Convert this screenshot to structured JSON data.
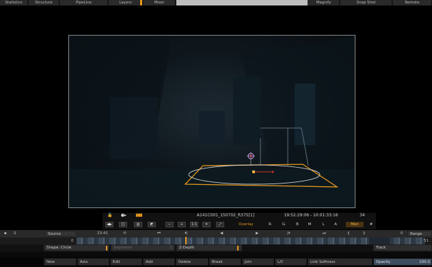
{
  "top_tabs": [
    {
      "label": "Statistics"
    },
    {
      "label": "Structure"
    },
    {
      "label": "PipeLine"
    },
    {
      "label": "Layers"
    },
    {
      "label": "Mixer"
    },
    {
      "label": "Magnify"
    },
    {
      "label": "Snap Shot"
    },
    {
      "label": "Remote"
    }
  ],
  "player": {
    "clip_name": "A141C001_150702_R375[1]",
    "timecode_range": "19:52:29:06 - 10:01:33:16",
    "frame_count": "34",
    "modes": [
      "Overlay",
      "R",
      "G",
      "B",
      "M",
      "L",
      "A",
      "Mon"
    ],
    "hash_icon": "#"
  },
  "source_row": {
    "s_label": "S",
    "source_label": "Source",
    "source_value": "23:41",
    "range_label": "Range",
    "zero_left": "0",
    "zero_right": "0",
    "value_right": "51"
  },
  "shape_row": {
    "shape_label": "Shape: Circle",
    "segments_label": "Segments",
    "segments_value": "1",
    "zdepth_label": "Z-Depth",
    "track_label": "Track"
  },
  "button_row": [
    {
      "label": "New",
      "disabled": false
    },
    {
      "label": "Axis",
      "disabled": false
    },
    {
      "label": "Edit",
      "disabled": false
    },
    {
      "label": "Add",
      "disabled": false
    },
    {
      "label": "Delete",
      "disabled": false
    },
    {
      "label": "Break",
      "disabled": false
    },
    {
      "label": "Join",
      "disabled": false
    },
    {
      "label": "L/C",
      "disabled": false
    },
    {
      "label": "Link Softness",
      "disabled": false
    },
    {
      "label": "Opacity",
      "disabled": false
    }
  ],
  "opacity_value": "100.0",
  "colors": {
    "accent": "#e79a1c",
    "panel": "#2a2a2a",
    "timeline": "#3c4a58"
  }
}
